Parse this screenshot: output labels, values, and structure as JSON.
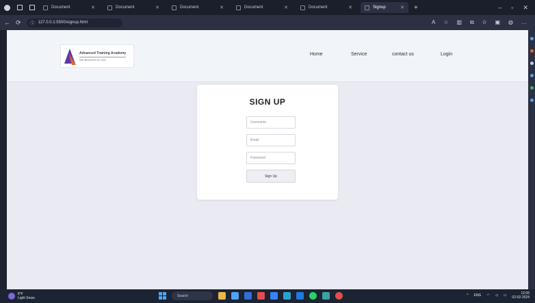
{
  "browser": {
    "tabs": [
      {
        "label": "Document",
        "active": false
      },
      {
        "label": "Document",
        "active": false
      },
      {
        "label": "Document",
        "active": false
      },
      {
        "label": "Document",
        "active": false
      },
      {
        "label": "Document",
        "active": false
      },
      {
        "label": "Signup",
        "active": true
      }
    ],
    "new_tab": "+",
    "address": "127.0.0.1:5500/signup.html"
  },
  "navbar": {
    "logo": {
      "line1": "Advanced Training Academy",
      "line2": "WE BELIEVE IN YOU"
    },
    "links": [
      "Home",
      "Service",
      "contact us",
      "Login"
    ]
  },
  "signup": {
    "title": "SIGN UP",
    "username_placeholder": "Username",
    "email_placeholder": "Email",
    "password_placeholder": "Password",
    "submit_label": "Sign Up"
  },
  "taskbar": {
    "weather_temp": "8°F",
    "weather_desc": "Light Snow",
    "search_label": "Search",
    "lang": "ENG",
    "time": "12:05",
    "date": "02-02-2024"
  },
  "colors": {
    "page_bg": "#e9eaf2",
    "navbar_bg": "#f1f4f9",
    "logo_purple": "#5b3aa6",
    "logo_orange": "#e8612c",
    "taskbar_bg": "#1c2333"
  }
}
